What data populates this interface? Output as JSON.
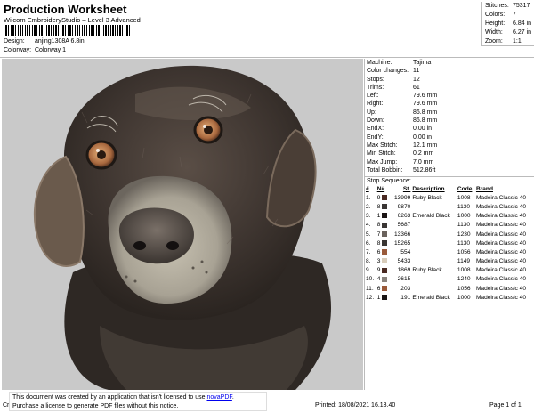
{
  "header": {
    "title": "Production Worksheet",
    "subtitle": "Wilcom EmbroideryStudio – Level 3 Advanced",
    "design_label": "Design:",
    "design_value": "anjing1308A 6.8in",
    "colorway_label": "Colorway:",
    "colorway_value": "Colorway 1"
  },
  "summary": [
    {
      "k": "Stitches:",
      "v": "75317"
    },
    {
      "k": "Colors:",
      "v": "7"
    },
    {
      "k": "Height:",
      "v": "6.84 in"
    },
    {
      "k": "Width:",
      "v": "6.27 in"
    },
    {
      "k": "Zoom:",
      "v": "1:1"
    }
  ],
  "properties": [
    {
      "k": "Machine:",
      "v": "Tajima"
    },
    {
      "k": "Color changes:",
      "v": "11"
    },
    {
      "k": "Stops:",
      "v": "12"
    },
    {
      "k": "Trims:",
      "v": "61"
    },
    {
      "k": "Left:",
      "v": "79.6 mm"
    },
    {
      "k": "Right:",
      "v": "79.6 mm"
    },
    {
      "k": "Up:",
      "v": "86.8 mm"
    },
    {
      "k": "Down:",
      "v": "86.8 mm"
    },
    {
      "k": "EndX:",
      "v": "0.00 in"
    },
    {
      "k": "EndY:",
      "v": "0.00 in"
    },
    {
      "k": "Max Stitch:",
      "v": "12.1 mm"
    },
    {
      "k": "Min Stitch:",
      "v": "0.2 mm"
    },
    {
      "k": "Max Jump:",
      "v": "7.0 mm"
    },
    {
      "k": "Total Bobbin:",
      "v": "512.86ft"
    }
  ],
  "sequence": {
    "title": "Stop Sequence:",
    "headers": [
      "#",
      "N#",
      "St.",
      "Description",
      "Code",
      "Brand"
    ],
    "rows": [
      {
        "n": "1.",
        "needle": "9",
        "color": "#4a2a22",
        "st": "13999",
        "desc": "Ruby Black",
        "code": "1008",
        "brand": "Madeira Classic 40"
      },
      {
        "n": "2.",
        "needle": "8",
        "color": "#3a3634",
        "st": "9870",
        "desc": "",
        "code": "1130",
        "brand": "Madeira Classic 40"
      },
      {
        "n": "3.",
        "needle": "1",
        "color": "#1a1414",
        "st": "6263",
        "desc": "Emerald Black",
        "code": "1000",
        "brand": "Madeira Classic 40"
      },
      {
        "n": "4.",
        "needle": "8",
        "color": "#3a3634",
        "st": "5687",
        "desc": "",
        "code": "1130",
        "brand": "Madeira Classic 40"
      },
      {
        "n": "5.",
        "needle": "7",
        "color": "#6a625c",
        "st": "13366",
        "desc": "",
        "code": "1230",
        "brand": "Madeira Classic 40"
      },
      {
        "n": "6.",
        "needle": "8",
        "color": "#3a3634",
        "st": "15265",
        "desc": "",
        "code": "1130",
        "brand": "Madeira Classic 40"
      },
      {
        "n": "7.",
        "needle": "6",
        "color": "#9a5a3a",
        "st": "554",
        "desc": "",
        "code": "1056",
        "brand": "Madeira Classic 40"
      },
      {
        "n": "8.",
        "needle": "3",
        "color": "#d8ccba",
        "st": "5433",
        "desc": "",
        "code": "1149",
        "brand": "Madeira Classic 40"
      },
      {
        "n": "9.",
        "needle": "9",
        "color": "#4a2a22",
        "st": "1869",
        "desc": "Ruby Black",
        "code": "1008",
        "brand": "Madeira Classic 40"
      },
      {
        "n": "10.",
        "needle": "4",
        "color": "#8a847e",
        "st": "2615",
        "desc": "",
        "code": "1240",
        "brand": "Madeira Classic 40"
      },
      {
        "n": "11.",
        "needle": "6",
        "color": "#9a5a3a",
        "st": "203",
        "desc": "",
        "code": "1056",
        "brand": "Madeira Classic 40"
      },
      {
        "n": "12.",
        "needle": "1",
        "color": "#1a1414",
        "st": "191",
        "desc": "Emerald Black",
        "code": "1000",
        "brand": "Madeira Classic 40"
      }
    ]
  },
  "footer": {
    "note_line1": "This document was created by an application that isn't licensed to use",
    "note_link": "novaPDF",
    "note_line2": "Purchase a license to generate PDF files without this notice.",
    "cr": "Cr",
    "printed": "Printed: 18/08/2021 16.13.40",
    "page": "Page 1 of 1"
  }
}
